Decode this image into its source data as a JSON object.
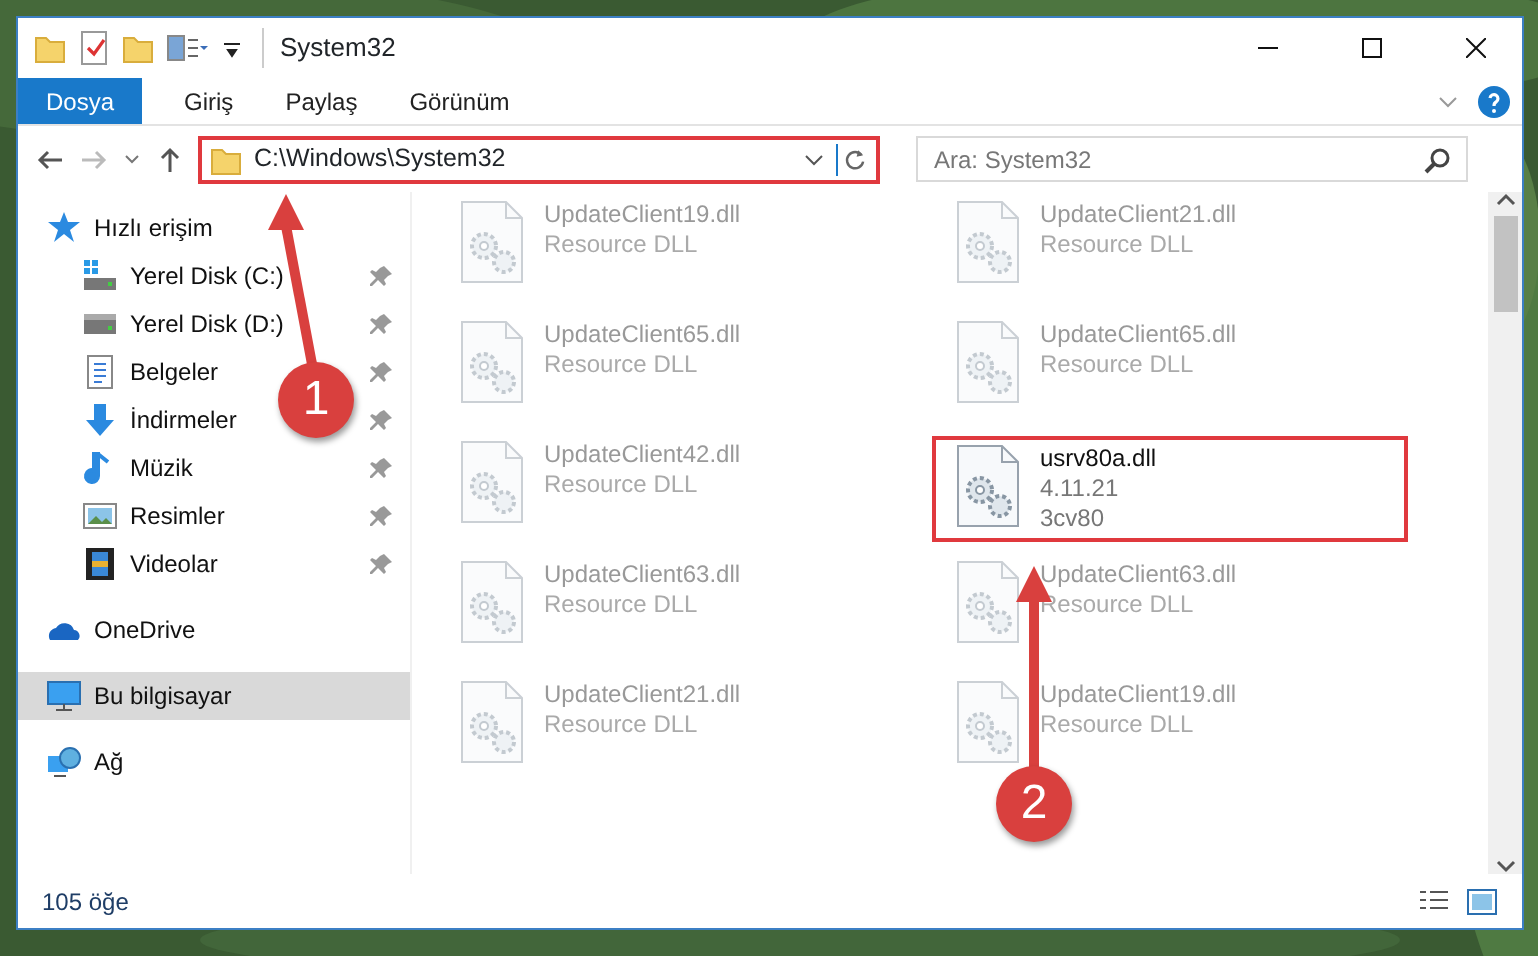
{
  "window": {
    "title": "System32"
  },
  "ribbon": {
    "tabs": [
      {
        "label": "Dosya",
        "selected": true
      },
      {
        "label": "Giriş",
        "selected": false
      },
      {
        "label": "Paylaş",
        "selected": false
      },
      {
        "label": "Görünüm",
        "selected": false
      }
    ]
  },
  "address": {
    "path": "C:\\Windows\\System32"
  },
  "search": {
    "placeholder": "Ara: System32"
  },
  "sidebar": {
    "items": [
      {
        "label": "Hızlı erişim",
        "kind": "star",
        "selected": false,
        "children": [
          {
            "label": "Yerel Disk (C:)",
            "kind": "winDrive",
            "pinned": true
          },
          {
            "label": "Yerel Disk (D:)",
            "kind": "drive",
            "pinned": true
          },
          {
            "label": "Belgeler",
            "kind": "docs",
            "pinned": true
          },
          {
            "label": "İndirmeler",
            "kind": "download",
            "pinned": true
          },
          {
            "label": "Müzik",
            "kind": "music",
            "pinned": true
          },
          {
            "label": "Resimler",
            "kind": "pictures",
            "pinned": true
          },
          {
            "label": "Videolar",
            "kind": "videos",
            "pinned": true
          }
        ]
      },
      {
        "label": "OneDrive",
        "kind": "cloud",
        "selected": false
      },
      {
        "label": "Bu bilgisayar",
        "kind": "pc",
        "selected": true
      },
      {
        "label": "Ağ",
        "kind": "network",
        "selected": false
      }
    ]
  },
  "files": [
    {
      "name": "UpdateClient19.dll",
      "details": [
        "Resource DLL"
      ],
      "highlighted": false
    },
    {
      "name": "UpdateClient21.dll",
      "details": [
        "Resource DLL"
      ],
      "highlighted": false
    },
    {
      "name": "UpdateClient65.dll",
      "details": [
        "Resource DLL"
      ],
      "highlighted": false
    },
    {
      "name": "UpdateClient65.dll",
      "details": [
        "Resource DLL"
      ],
      "highlighted": false
    },
    {
      "name": "UpdateClient42.dll",
      "details": [
        "Resource DLL"
      ],
      "highlighted": false
    },
    {
      "name": "usrv80a.dll",
      "details": [
        "4.11.21",
        "3cv80"
      ],
      "highlighted": true
    },
    {
      "name": "UpdateClient63.dll",
      "details": [
        "Resource DLL"
      ],
      "highlighted": false
    },
    {
      "name": "UpdateClient63.dll",
      "details": [
        "Resource DLL"
      ],
      "highlighted": false
    },
    {
      "name": "UpdateClient21.dll",
      "details": [
        "Resource DLL"
      ],
      "highlighted": false
    },
    {
      "name": "UpdateClient19.dll",
      "details": [
        "Resource DLL"
      ],
      "highlighted": false
    }
  ],
  "status_bar": {
    "count": "105 öğe"
  },
  "callouts": [
    {
      "number": "1"
    },
    {
      "number": "2"
    }
  ]
}
